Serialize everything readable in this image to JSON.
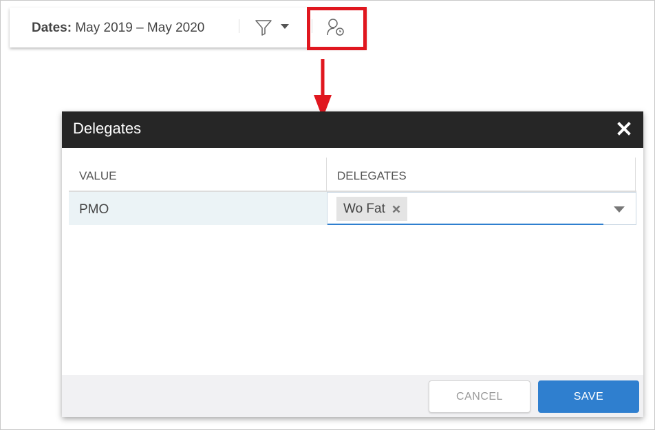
{
  "toolbar": {
    "dates_label": "Dates:",
    "dates_value": "May 2019 – May 2020",
    "filter_icon": "filter-icon",
    "dropdown_icon": "caret-down-icon",
    "delegate_icon": "user-clock-icon"
  },
  "annotation": {
    "highlight_color": "#e0171f"
  },
  "dialog": {
    "title": "Delegates",
    "close_icon": "close-icon",
    "columns": [
      "VALUE",
      "DELEGATES"
    ],
    "rows": [
      {
        "value": "PMO",
        "delegates": [
          "Wo Fat"
        ]
      }
    ],
    "cancel_label": "CANCEL",
    "save_label": "SAVE",
    "accent_color": "#2f7fcf",
    "header_color": "#262626"
  }
}
